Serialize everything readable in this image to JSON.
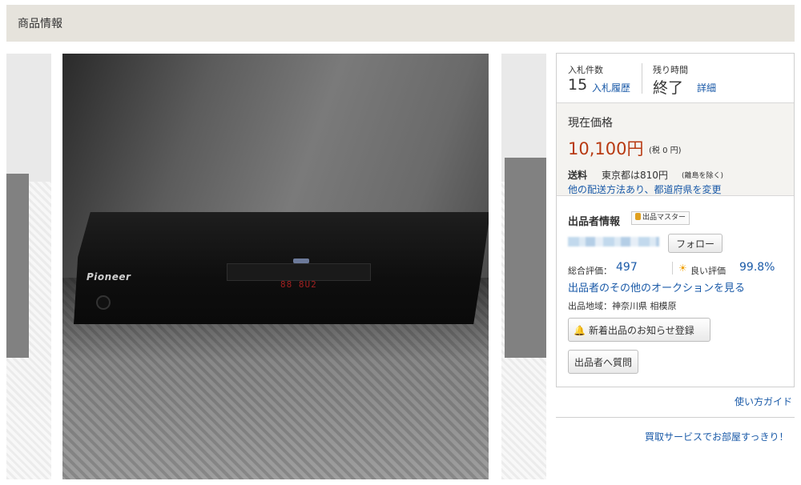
{
  "header": {
    "title": "商品情報"
  },
  "gallery": {
    "brand_text": "Pioneer",
    "display_text": "88 8U2"
  },
  "bids": {
    "count_label": "入札件数",
    "count": "15",
    "history_link": "入札履歴",
    "time_label": "残り時間",
    "time_value": "終了",
    "detail_link": "詳細"
  },
  "price": {
    "label": "現在価格",
    "value": "10,100円",
    "tax": "(税 0 円)",
    "shipping_label": "送料",
    "shipping_value": "東京都は810円",
    "shipping_note": "(離島を除く)",
    "shipping_link": "他の配送方法あり、都道府県を変更"
  },
  "seller": {
    "title": "出品者情報",
    "badge": "出品マスター",
    "follow_button": "フォロー",
    "total_label": "総合評価：",
    "total_value": "497",
    "good_label": "良い評価",
    "good_value": "99.8%",
    "other_link": "出品者のその他のオークションを見る",
    "region": "出品地域：神奈川県 相模原",
    "notify_button": "新着出品のお知らせ登録",
    "ask_button": "出品者へ質問"
  },
  "footer": {
    "guide_link": "使い方ガイド",
    "buy_link": "買取サービスでお部屋すっきり！"
  },
  "colors": {
    "price": "#b83a12",
    "link": "#1a5aa8",
    "header_bg": "#e6e3dc",
    "price_bg": "#f4f3f0"
  },
  "icons": [
    "sun-icon",
    "bell-icon",
    "badge-icon"
  ]
}
